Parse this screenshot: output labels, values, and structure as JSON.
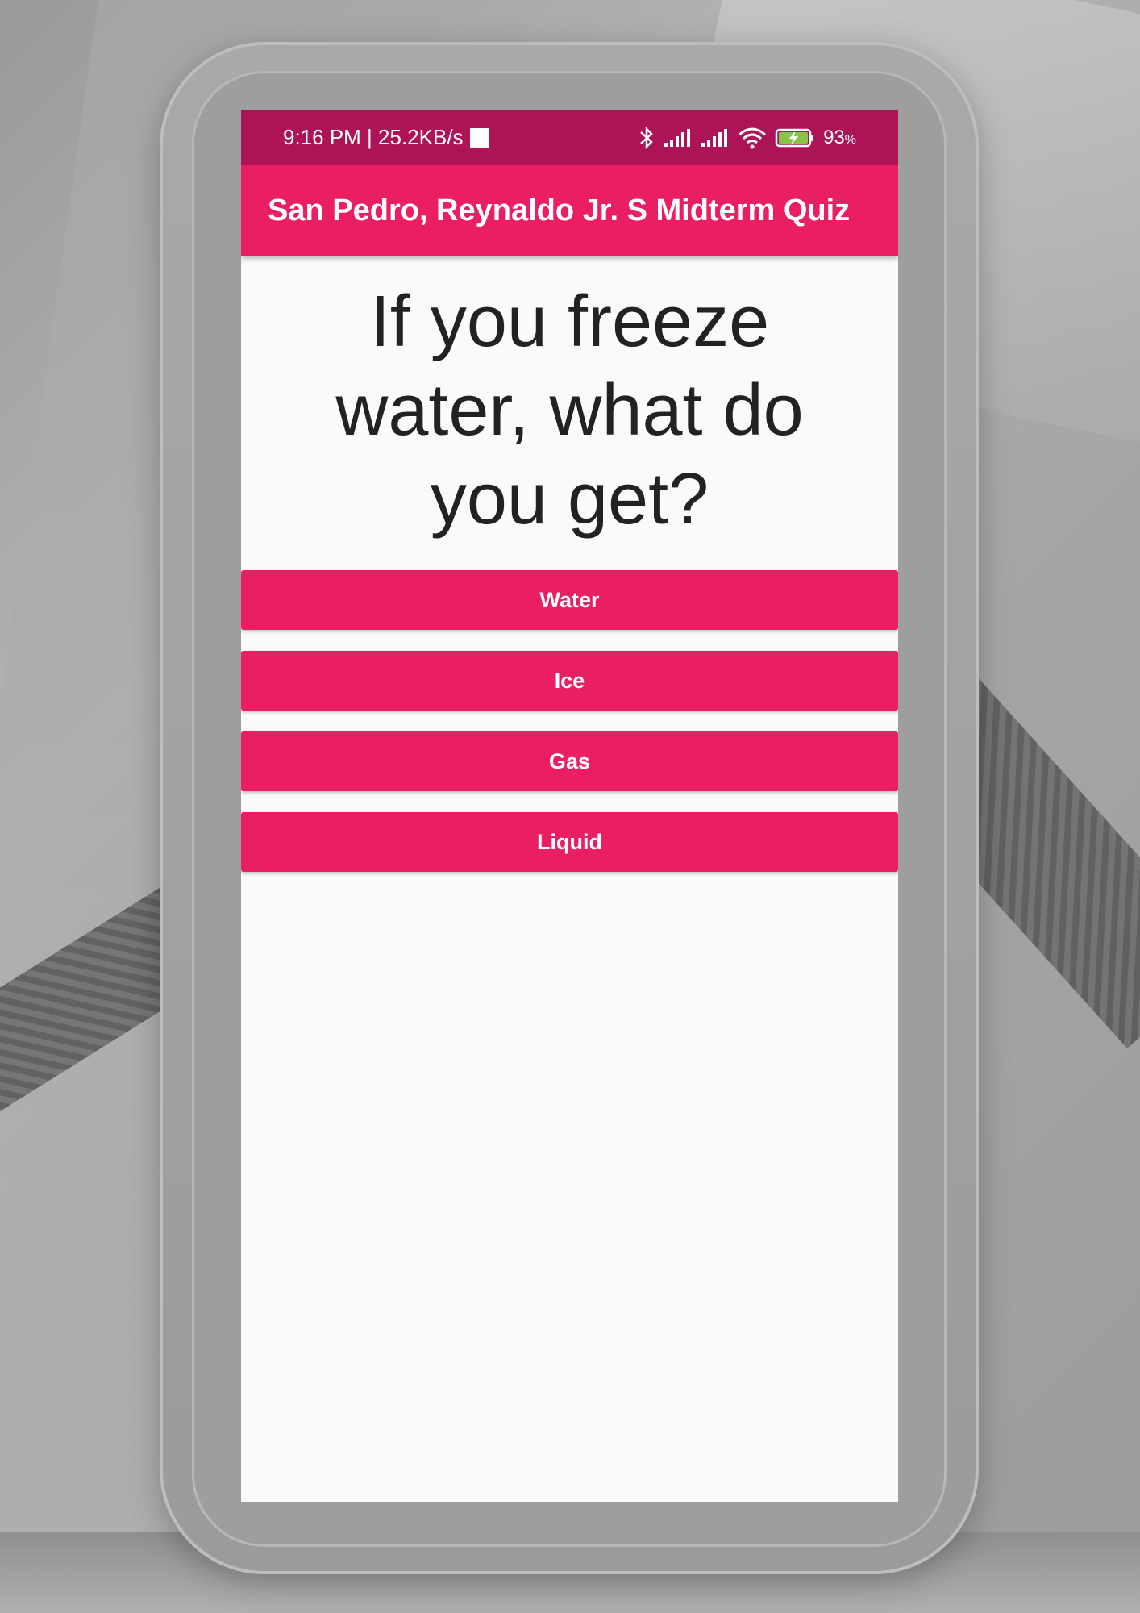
{
  "status_bar": {
    "time": "9:16 PM | 25.2KB/s",
    "battery_percent": "93",
    "battery_unit": "%",
    "icons": [
      "bluetooth-icon",
      "signal-icon",
      "signal-icon",
      "wifi-icon",
      "battery-charging-icon"
    ]
  },
  "app_bar": {
    "title": "San Pedro, Reynaldo Jr. S Midterm Quiz"
  },
  "quiz": {
    "question": "If you freeze water, what do you get?",
    "answers": [
      {
        "label": "Water"
      },
      {
        "label": "Ice"
      },
      {
        "label": "Gas"
      },
      {
        "label": "Liquid"
      }
    ]
  },
  "colors": {
    "status_bar": "#ad1457",
    "primary": "#e91e63",
    "background": "#fafafa",
    "question_text": "#222222"
  }
}
